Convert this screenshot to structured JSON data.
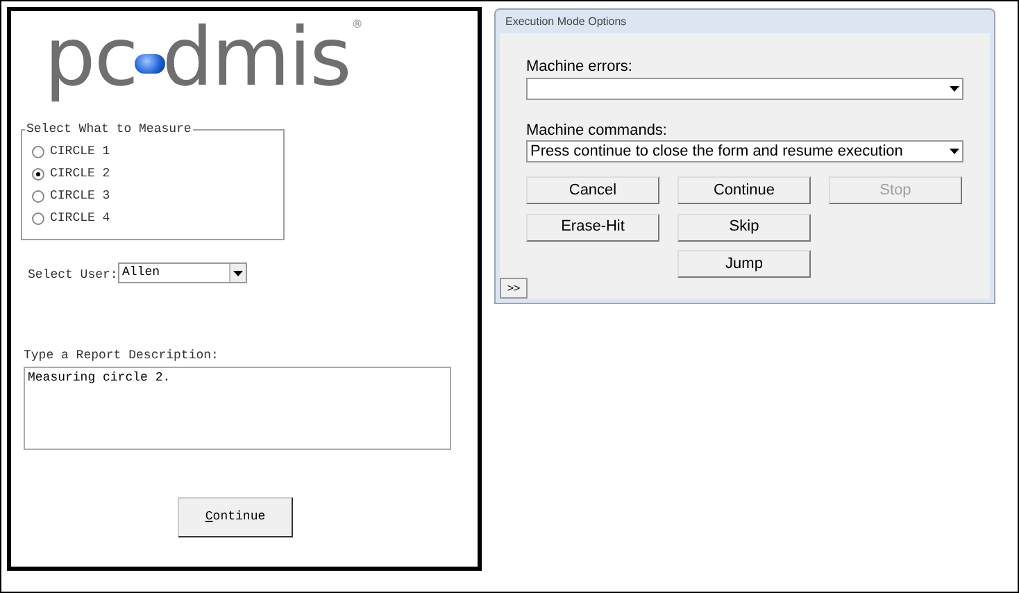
{
  "form": {
    "logo": {
      "left": "pc",
      "right": "dmis",
      "mark": "®"
    },
    "measure_group": {
      "title": "Select What to Measure",
      "options": [
        {
          "label": "CIRCLE 1",
          "selected": false
        },
        {
          "label": "CIRCLE 2",
          "selected": true
        },
        {
          "label": "CIRCLE 3",
          "selected": false
        },
        {
          "label": "CIRCLE 4",
          "selected": false
        }
      ]
    },
    "user": {
      "label": "Select User:",
      "value": "Allen"
    },
    "description": {
      "label": "Type a Report Description:",
      "value": "Measuring circle 2."
    },
    "continue_button": {
      "label": "Continue",
      "first_letter_underlined": true
    }
  },
  "dialog": {
    "title": "Execution Mode Options",
    "errors": {
      "label": "Machine errors:"
    },
    "commands": {
      "label": "Machine commands:",
      "value": "Press continue to close the form and resume execution"
    },
    "button_rows": [
      [
        {
          "label": "Cancel",
          "disabled": false
        },
        {
          "label": "Continue",
          "disabled": false
        },
        {
          "label": "Stop",
          "disabled": true
        }
      ],
      [
        {
          "label": "Erase-Hit",
          "disabled": false
        },
        {
          "label": "Skip",
          "disabled": false
        },
        null
      ],
      [
        null,
        {
          "label": "Jump",
          "disabled": false
        },
        null
      ]
    ],
    "expand_button": ">>"
  }
}
